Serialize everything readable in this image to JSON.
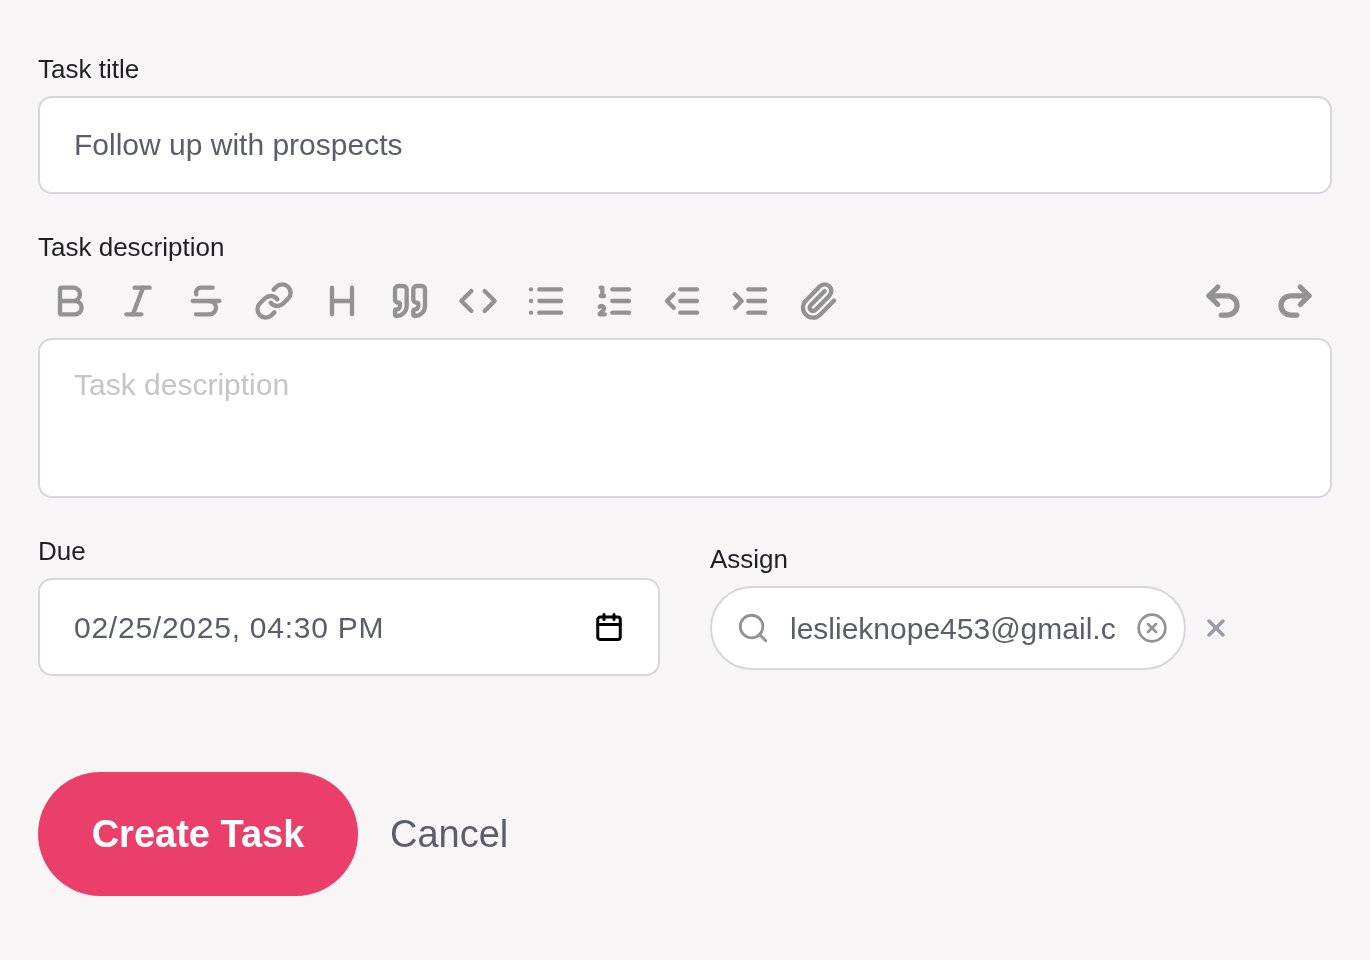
{
  "title_field": {
    "label": "Task title",
    "value": "Follow up with prospects"
  },
  "description_field": {
    "label": "Task description",
    "placeholder": "Task description"
  },
  "due_field": {
    "label": "Due",
    "value": "02/25/2025, 04:30 PM"
  },
  "assign_field": {
    "label": "Assign",
    "value": "leslieknope453@gmail.c"
  },
  "buttons": {
    "primary": "Create Task",
    "secondary": "Cancel"
  }
}
